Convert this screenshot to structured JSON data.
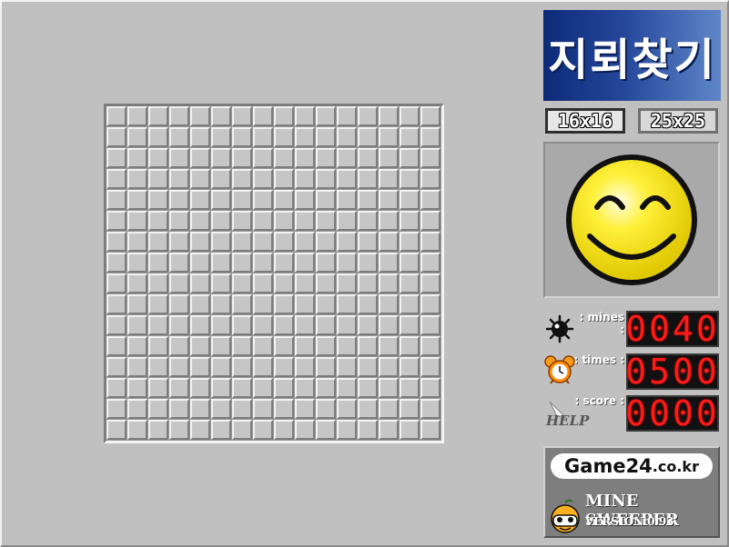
{
  "game": {
    "title_korean": "지뢰찾기",
    "board_size": "16x16",
    "rows": 16,
    "cols": 16
  },
  "size_options": [
    {
      "label": "16x16",
      "selected": true
    },
    {
      "label": "25x25",
      "selected": false
    }
  ],
  "face": {
    "state": "smiling",
    "color": "#ffee22"
  },
  "stats": {
    "mines_label": ": mines :",
    "mines_value": "0040",
    "times_label": ": times :",
    "times_value": "0500",
    "score_label": ": score :",
    "score_value": "0000"
  },
  "help": {
    "label": "HELP"
  },
  "credits": {
    "site_main": "Game24",
    "site_sub": ".co.kr",
    "game_name": "MINE SWEEPER",
    "version": "VERSION 0.93"
  },
  "colors": {
    "background": "#c0c0c0",
    "banner": "#1e3f8f",
    "lcd_digit": "#ff1a1a",
    "lcd_bg": "#111111"
  }
}
